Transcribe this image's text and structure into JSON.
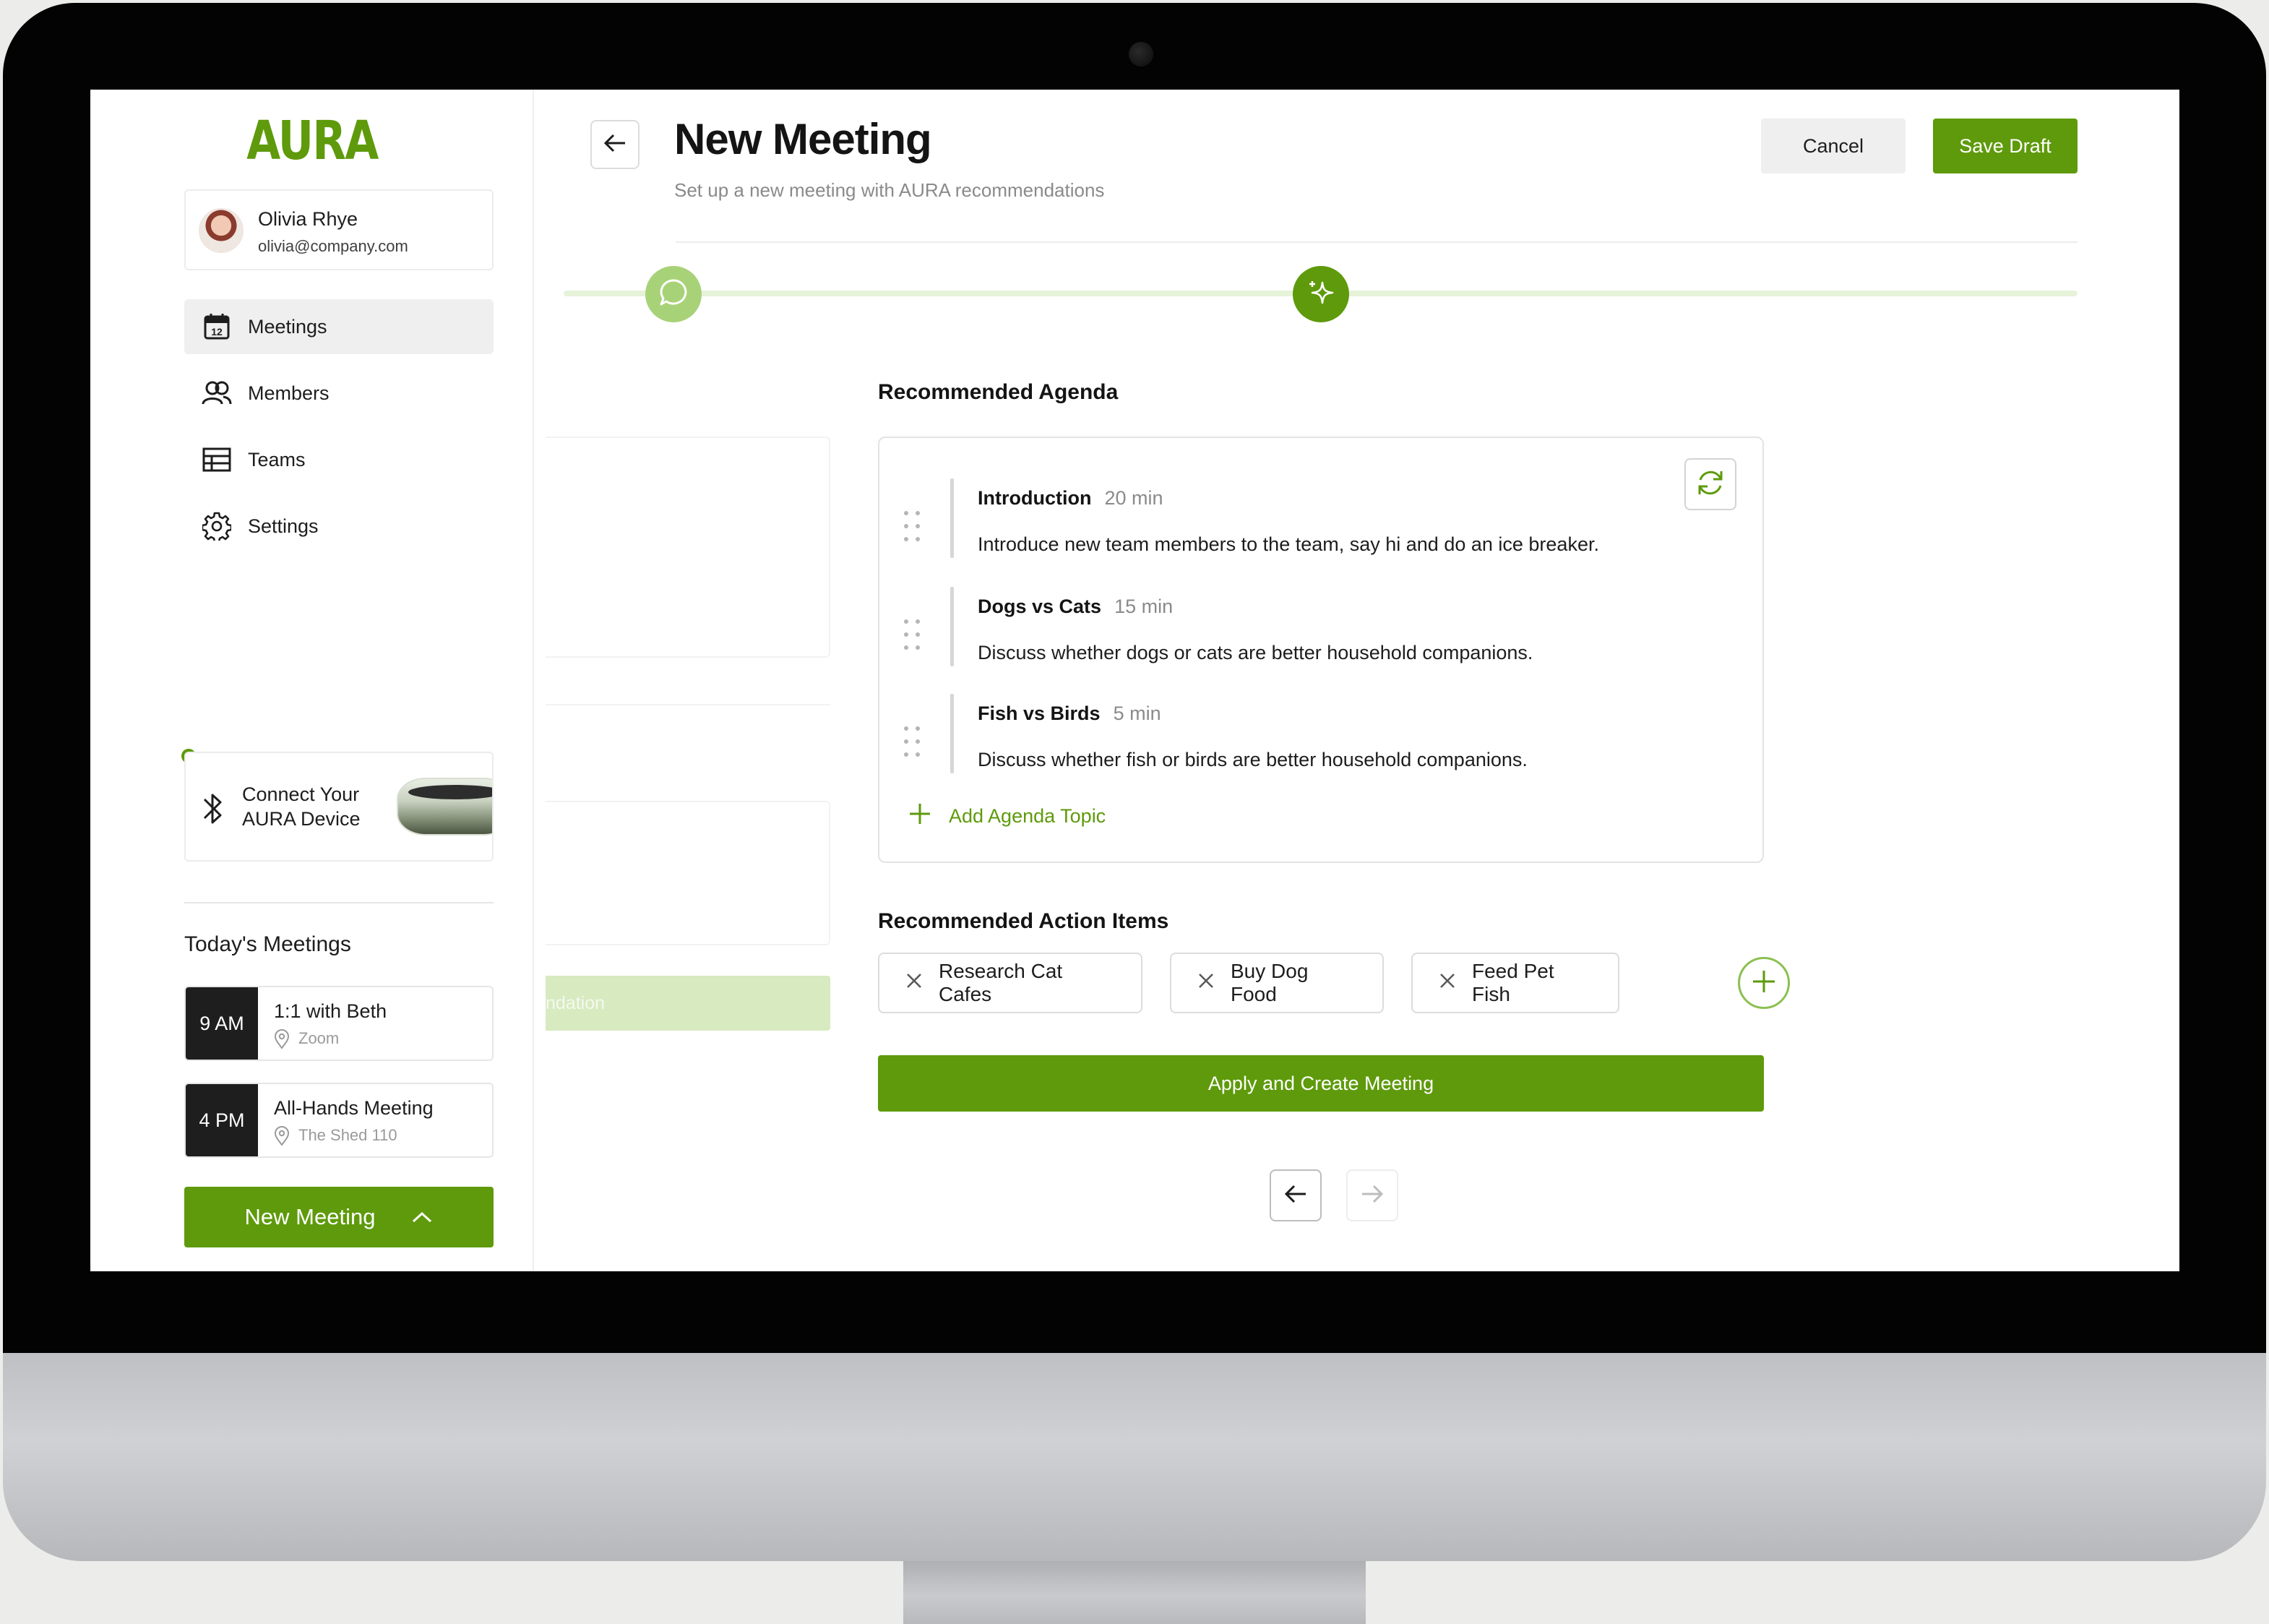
{
  "app": {
    "logo": "AURA"
  },
  "user": {
    "name": "Olivia Rhye",
    "email": "olivia@company.com"
  },
  "sidebar": {
    "items": [
      {
        "label": "Meetings",
        "icon": "calendar-icon",
        "active": true
      },
      {
        "label": "Members",
        "icon": "users-icon",
        "active": false
      },
      {
        "label": "Teams",
        "icon": "table-icon",
        "active": false
      },
      {
        "label": "Settings",
        "icon": "gear-icon",
        "active": false
      }
    ],
    "calendar_day": "12"
  },
  "device": {
    "line1": "Connect Your",
    "line2": "AURA Device",
    "icon": "bluetooth-icon",
    "status_color": "#5e9a0b"
  },
  "today": {
    "title": "Today's Meetings",
    "meetings": [
      {
        "time": "9 AM",
        "title": "1:1 with Beth",
        "location": "Zoom"
      },
      {
        "time": "4 PM",
        "title": "All-Hands Meeting",
        "location": "The Shed 110"
      }
    ],
    "new_meeting_label": "New Meeting"
  },
  "header": {
    "title": "New Meeting",
    "subtitle": "Set up a new meeting with AURA recommendations",
    "cancel_label": "Cancel",
    "save_label": "Save Draft"
  },
  "steps": [
    {
      "icon": "chat-bubble-icon",
      "state": "complete"
    },
    {
      "icon": "sparkle-icon",
      "state": "current"
    }
  ],
  "ghost": {
    "button_fragment": "ndation"
  },
  "agenda": {
    "title": "Recommended Agenda",
    "items": [
      {
        "title": "Introduction",
        "duration": "20 min",
        "description": "Introduce new team members to the team, say hi and do an ice breaker."
      },
      {
        "title": "Dogs vs Cats",
        "duration": "15 min",
        "description": "Discuss whether dogs or cats are better household companions."
      },
      {
        "title": "Fish vs Birds",
        "duration": "5 min",
        "description": "Discuss whether fish or birds are better household companions."
      }
    ],
    "add_label": "Add Agenda Topic"
  },
  "actions": {
    "title": "Recommended Action Items",
    "items": [
      "Research Cat Cafes",
      "Buy Dog Food",
      "Feed Pet Fish"
    ]
  },
  "apply_label": "Apply and Create Meeting",
  "colors": {
    "accent": "#5e9a0b",
    "accent_light": "#a8d278",
    "track": "#e7f3d9"
  }
}
